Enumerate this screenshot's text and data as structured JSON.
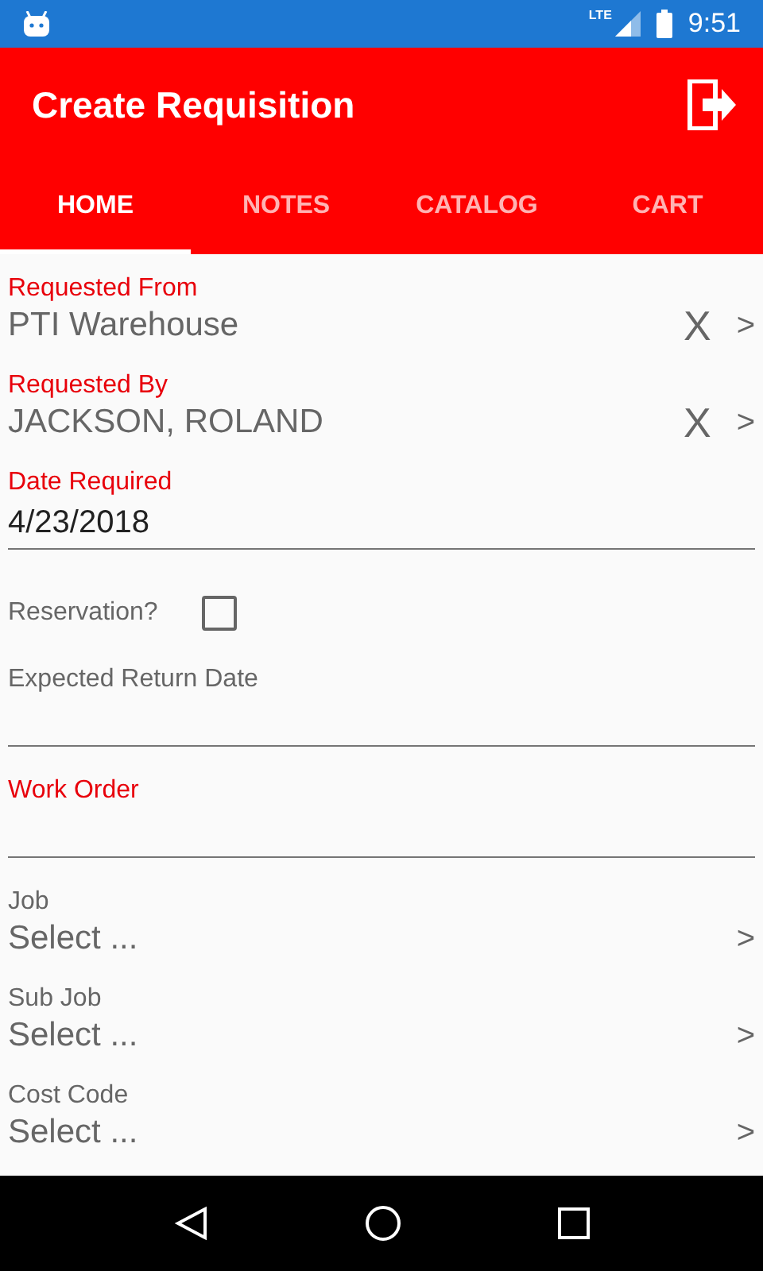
{
  "status_bar": {
    "network": "LTE",
    "time": "9:51"
  },
  "toolbar": {
    "title": "Create Requisition"
  },
  "tabs": [
    {
      "label": "HOME",
      "selected": true
    },
    {
      "label": "NOTES",
      "selected": false
    },
    {
      "label": "CATALOG",
      "selected": false
    },
    {
      "label": "CART",
      "selected": false
    }
  ],
  "fields": [
    {
      "kind": "lookup",
      "label": "Requested From",
      "value": "PTI Warehouse",
      "required": true,
      "clear": "X",
      "go": ">"
    },
    {
      "kind": "lookup",
      "label": "Requested By",
      "value": "JACKSON, ROLAND",
      "required": true,
      "clear": "X",
      "go": ">"
    },
    {
      "kind": "input",
      "label": "Date Required",
      "value": "4/23/2018",
      "required": true
    },
    {
      "kind": "checkbox",
      "label": "Reservation?",
      "checked": false
    },
    {
      "kind": "input",
      "label": "Expected Return Date",
      "required": false
    },
    {
      "kind": "input",
      "label": "Work Order",
      "required": true
    },
    {
      "kind": "lookup",
      "label": "Job",
      "value": "Select ...",
      "required": false,
      "go": ">"
    },
    {
      "kind": "lookup",
      "label": "Sub Job",
      "value": "Select ...",
      "required": false,
      "go": ">"
    },
    {
      "kind": "lookup",
      "label": "Cost Code",
      "value": "Select ...",
      "required": false,
      "go": ">"
    }
  ]
}
